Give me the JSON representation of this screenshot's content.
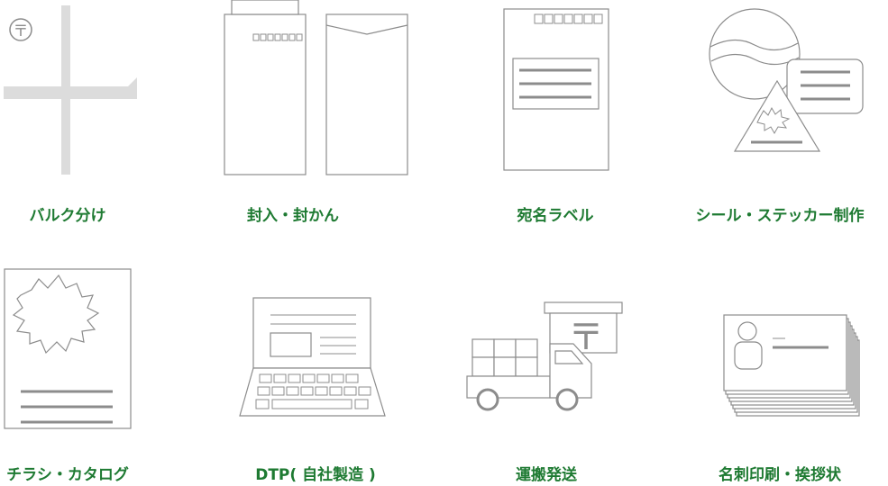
{
  "colors": {
    "label_green": "#1e7a32",
    "line_gray": "#8c8c8c",
    "bulk_gray": "#dcdcdc"
  },
  "services": [
    {
      "label": "バルク分け",
      "icon": "bulk-sort-icon"
    },
    {
      "label": "封入・封かん",
      "icon": "envelope-icon"
    },
    {
      "label": "宛名ラベル",
      "icon": "address-label-icon"
    },
    {
      "label": "シール・ステッカー制作",
      "icon": "sticker-icon"
    },
    {
      "label": "チラシ・カタログ",
      "icon": "flyer-icon"
    },
    {
      "label": "DTP( 自社製造 )",
      "icon": "laptop-icon"
    },
    {
      "label": "運搬発送",
      "icon": "truck-icon"
    },
    {
      "label": "名刺印刷・挨拶状",
      "icon": "business-card-icon"
    }
  ],
  "postal_mark": "〒"
}
